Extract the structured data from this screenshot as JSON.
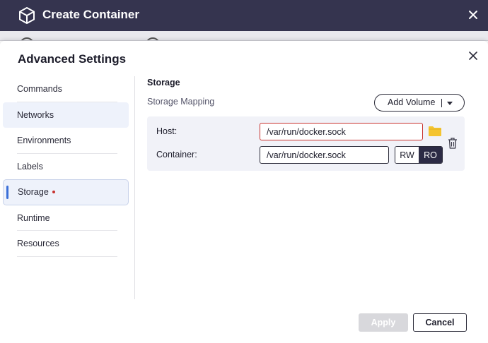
{
  "window": {
    "title": "Create Container",
    "icon": "cube-icon",
    "close_icon": "close-icon"
  },
  "dialog": {
    "title": "Advanced Settings",
    "close_icon": "close-icon"
  },
  "sidebar": {
    "items": [
      {
        "label": "Commands"
      },
      {
        "label": "Networks"
      },
      {
        "label": "Environments"
      },
      {
        "label": "Labels"
      },
      {
        "label": "Storage"
      },
      {
        "label": "Runtime"
      },
      {
        "label": "Resources"
      }
    ],
    "active": "Storage",
    "accent_color": "#3b6fd8",
    "modified_dot_color": "#c7312e"
  },
  "storage": {
    "section_title": "Storage",
    "mapping_label": "Storage Mapping",
    "add_volume_label": "Add Volume",
    "mapping": {
      "host_label": "Host:",
      "host_value": "/var/run/docker.sock",
      "container_label": "Container:",
      "container_value": "/var/run/docker.sock",
      "mode_rw": "RW",
      "mode_ro": "RO",
      "selected_mode": "RO",
      "error_border_color": "#c8322e",
      "folder_icon": "folder-icon",
      "delete_icon": "trash-icon"
    }
  },
  "footer": {
    "apply_label": "Apply",
    "cancel_label": "Cancel"
  },
  "colors": {
    "titlebar": "#35344f",
    "folder": "#f4c430"
  }
}
